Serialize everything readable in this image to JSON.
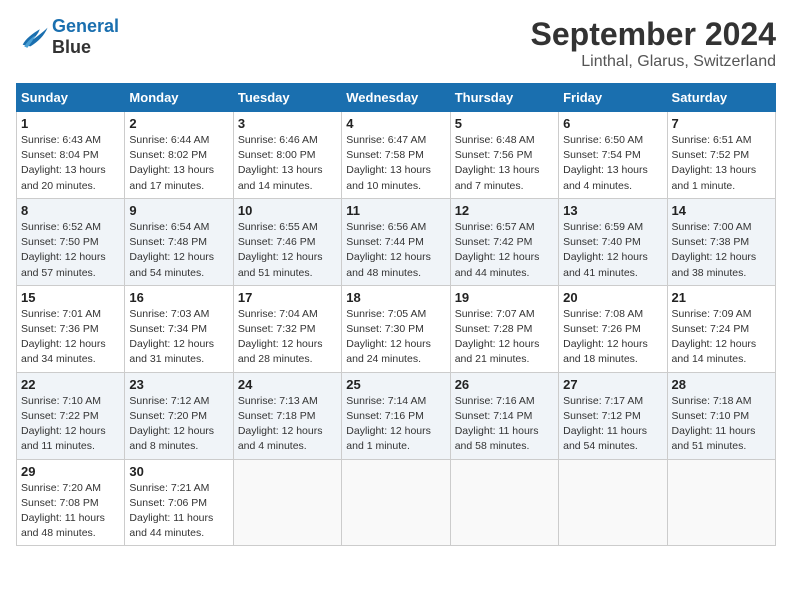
{
  "header": {
    "logo_line1": "General",
    "logo_line2": "Blue",
    "month_title": "September 2024",
    "location": "Linthal, Glarus, Switzerland"
  },
  "weekdays": [
    "Sunday",
    "Monday",
    "Tuesday",
    "Wednesday",
    "Thursday",
    "Friday",
    "Saturday"
  ],
  "weeks": [
    [
      {
        "day": "1",
        "info": "Sunrise: 6:43 AM\nSunset: 8:04 PM\nDaylight: 13 hours\nand 20 minutes."
      },
      {
        "day": "2",
        "info": "Sunrise: 6:44 AM\nSunset: 8:02 PM\nDaylight: 13 hours\nand 17 minutes."
      },
      {
        "day": "3",
        "info": "Sunrise: 6:46 AM\nSunset: 8:00 PM\nDaylight: 13 hours\nand 14 minutes."
      },
      {
        "day": "4",
        "info": "Sunrise: 6:47 AM\nSunset: 7:58 PM\nDaylight: 13 hours\nand 10 minutes."
      },
      {
        "day": "5",
        "info": "Sunrise: 6:48 AM\nSunset: 7:56 PM\nDaylight: 13 hours\nand 7 minutes."
      },
      {
        "day": "6",
        "info": "Sunrise: 6:50 AM\nSunset: 7:54 PM\nDaylight: 13 hours\nand 4 minutes."
      },
      {
        "day": "7",
        "info": "Sunrise: 6:51 AM\nSunset: 7:52 PM\nDaylight: 13 hours\nand 1 minute."
      }
    ],
    [
      {
        "day": "8",
        "info": "Sunrise: 6:52 AM\nSunset: 7:50 PM\nDaylight: 12 hours\nand 57 minutes."
      },
      {
        "day": "9",
        "info": "Sunrise: 6:54 AM\nSunset: 7:48 PM\nDaylight: 12 hours\nand 54 minutes."
      },
      {
        "day": "10",
        "info": "Sunrise: 6:55 AM\nSunset: 7:46 PM\nDaylight: 12 hours\nand 51 minutes."
      },
      {
        "day": "11",
        "info": "Sunrise: 6:56 AM\nSunset: 7:44 PM\nDaylight: 12 hours\nand 48 minutes."
      },
      {
        "day": "12",
        "info": "Sunrise: 6:57 AM\nSunset: 7:42 PM\nDaylight: 12 hours\nand 44 minutes."
      },
      {
        "day": "13",
        "info": "Sunrise: 6:59 AM\nSunset: 7:40 PM\nDaylight: 12 hours\nand 41 minutes."
      },
      {
        "day": "14",
        "info": "Sunrise: 7:00 AM\nSunset: 7:38 PM\nDaylight: 12 hours\nand 38 minutes."
      }
    ],
    [
      {
        "day": "15",
        "info": "Sunrise: 7:01 AM\nSunset: 7:36 PM\nDaylight: 12 hours\nand 34 minutes."
      },
      {
        "day": "16",
        "info": "Sunrise: 7:03 AM\nSunset: 7:34 PM\nDaylight: 12 hours\nand 31 minutes."
      },
      {
        "day": "17",
        "info": "Sunrise: 7:04 AM\nSunset: 7:32 PM\nDaylight: 12 hours\nand 28 minutes."
      },
      {
        "day": "18",
        "info": "Sunrise: 7:05 AM\nSunset: 7:30 PM\nDaylight: 12 hours\nand 24 minutes."
      },
      {
        "day": "19",
        "info": "Sunrise: 7:07 AM\nSunset: 7:28 PM\nDaylight: 12 hours\nand 21 minutes."
      },
      {
        "day": "20",
        "info": "Sunrise: 7:08 AM\nSunset: 7:26 PM\nDaylight: 12 hours\nand 18 minutes."
      },
      {
        "day": "21",
        "info": "Sunrise: 7:09 AM\nSunset: 7:24 PM\nDaylight: 12 hours\nand 14 minutes."
      }
    ],
    [
      {
        "day": "22",
        "info": "Sunrise: 7:10 AM\nSunset: 7:22 PM\nDaylight: 12 hours\nand 11 minutes."
      },
      {
        "day": "23",
        "info": "Sunrise: 7:12 AM\nSunset: 7:20 PM\nDaylight: 12 hours\nand 8 minutes."
      },
      {
        "day": "24",
        "info": "Sunrise: 7:13 AM\nSunset: 7:18 PM\nDaylight: 12 hours\nand 4 minutes."
      },
      {
        "day": "25",
        "info": "Sunrise: 7:14 AM\nSunset: 7:16 PM\nDaylight: 12 hours\nand 1 minute."
      },
      {
        "day": "26",
        "info": "Sunrise: 7:16 AM\nSunset: 7:14 PM\nDaylight: 11 hours\nand 58 minutes."
      },
      {
        "day": "27",
        "info": "Sunrise: 7:17 AM\nSunset: 7:12 PM\nDaylight: 11 hours\nand 54 minutes."
      },
      {
        "day": "28",
        "info": "Sunrise: 7:18 AM\nSunset: 7:10 PM\nDaylight: 11 hours\nand 51 minutes."
      }
    ],
    [
      {
        "day": "29",
        "info": "Sunrise: 7:20 AM\nSunset: 7:08 PM\nDaylight: 11 hours\nand 48 minutes."
      },
      {
        "day": "30",
        "info": "Sunrise: 7:21 AM\nSunset: 7:06 PM\nDaylight: 11 hours\nand 44 minutes."
      },
      {
        "day": "",
        "info": ""
      },
      {
        "day": "",
        "info": ""
      },
      {
        "day": "",
        "info": ""
      },
      {
        "day": "",
        "info": ""
      },
      {
        "day": "",
        "info": ""
      }
    ]
  ]
}
